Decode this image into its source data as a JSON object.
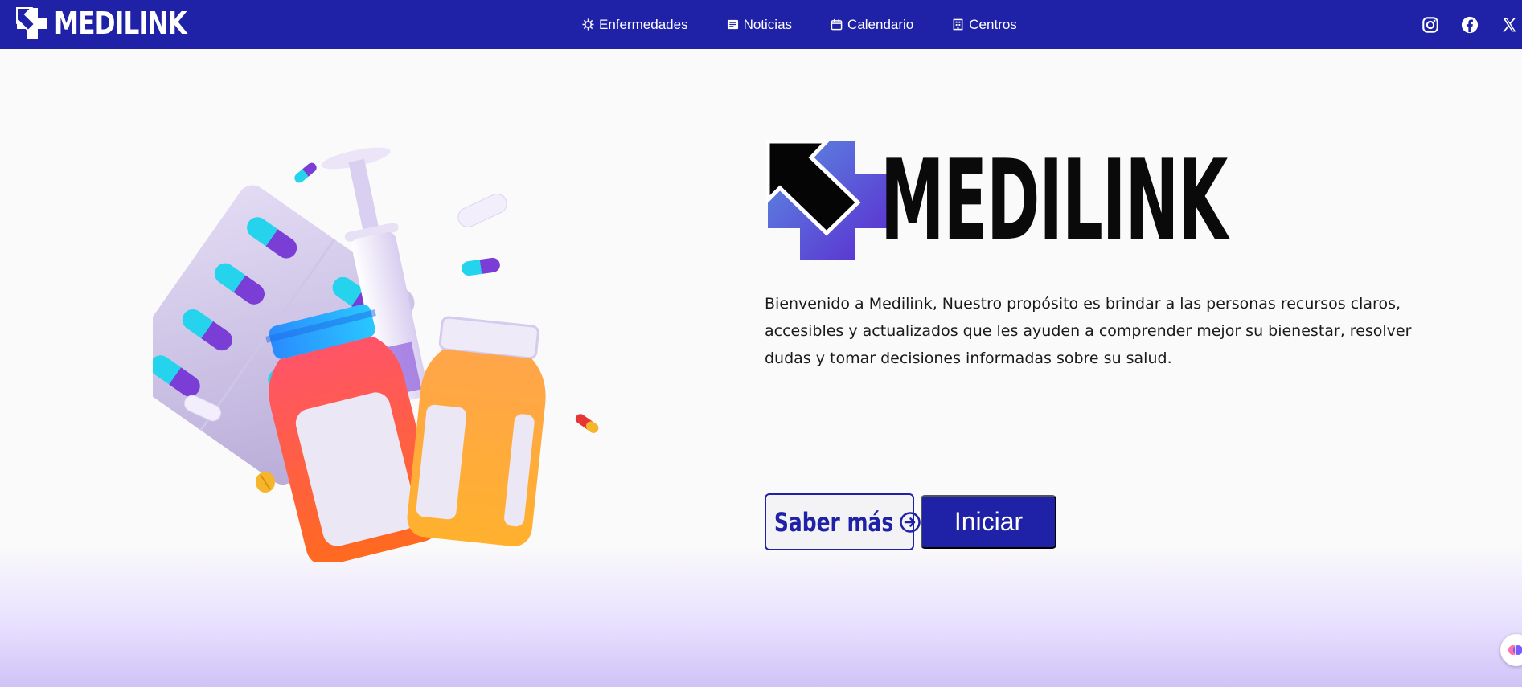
{
  "brand": {
    "name": "MEDILINK"
  },
  "nav": {
    "items": [
      {
        "label": "Enfermedades",
        "icon": "virus-icon"
      },
      {
        "label": "Noticias",
        "icon": "newspaper-icon"
      },
      {
        "label": "Calendario",
        "icon": "calendar-icon"
      },
      {
        "label": "Centros",
        "icon": "building-icon"
      }
    ]
  },
  "social": [
    "instagram-icon",
    "facebook-icon",
    "x-icon"
  ],
  "hero": {
    "title": "MEDILINK",
    "description": "Bienvenido a Medilink, Nuestro propósito es brindar a las personas recursos claros, accesibles y actualizados que les ayuden a comprender mejor su bienestar, resolver dudas y tomar decisiones informadas sobre su salud.",
    "btn_more": "Saber más",
    "btn_start": "Iniciar"
  },
  "colors": {
    "primary": "#1f22a6",
    "accent_purple": "#5b2bd1",
    "accent_blue": "#5b8fe0"
  }
}
